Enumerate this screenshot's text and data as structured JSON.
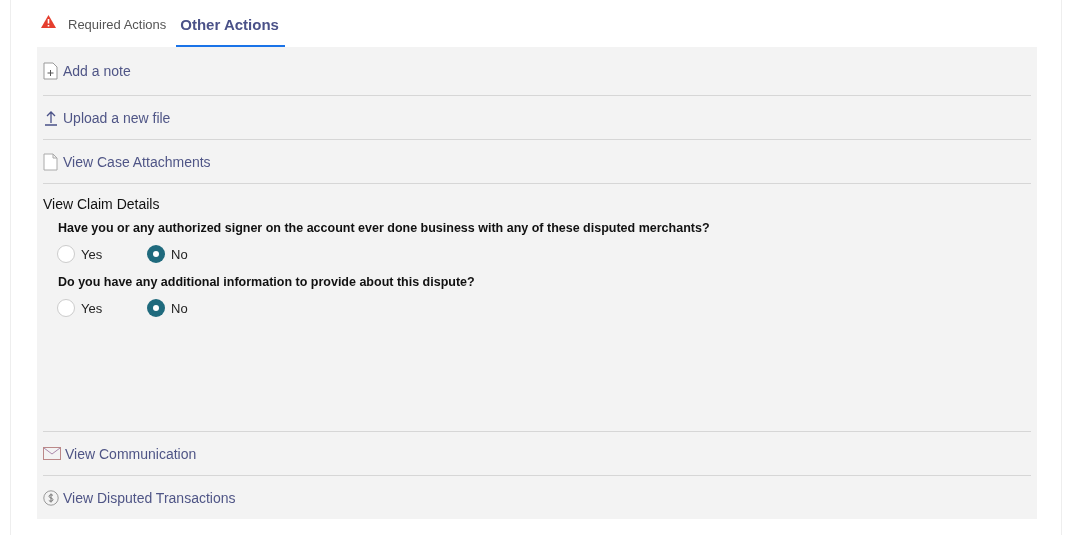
{
  "tabs": [
    {
      "label": "Required Actions",
      "selected": false,
      "alert": true
    },
    {
      "label": "Other Actions",
      "selected": true,
      "alert": false
    }
  ],
  "sections": [
    {
      "kind": "link",
      "label": "Add a note"
    },
    {
      "kind": "link",
      "label": "Upload a new file"
    },
    {
      "kind": "link",
      "label": "View Case Attachments"
    },
    {
      "kind": "details",
      "title": "View Claim Details",
      "questions": [
        {
          "text": "Have you or any authorized signer on the account ever done business with any of these disputed merchants?",
          "options": [
            {
              "label": "Yes",
              "selected": false
            },
            {
              "label": "No",
              "selected": true
            }
          ]
        },
        {
          "text": "Do you have any additional information to provide about this dispute?",
          "options": [
            {
              "label": "Yes",
              "selected": false
            },
            {
              "label": "No",
              "selected": true
            }
          ]
        }
      ]
    },
    {
      "kind": "link",
      "label": "View Communication"
    },
    {
      "kind": "link",
      "label": "View Disputed Transactions"
    }
  ]
}
